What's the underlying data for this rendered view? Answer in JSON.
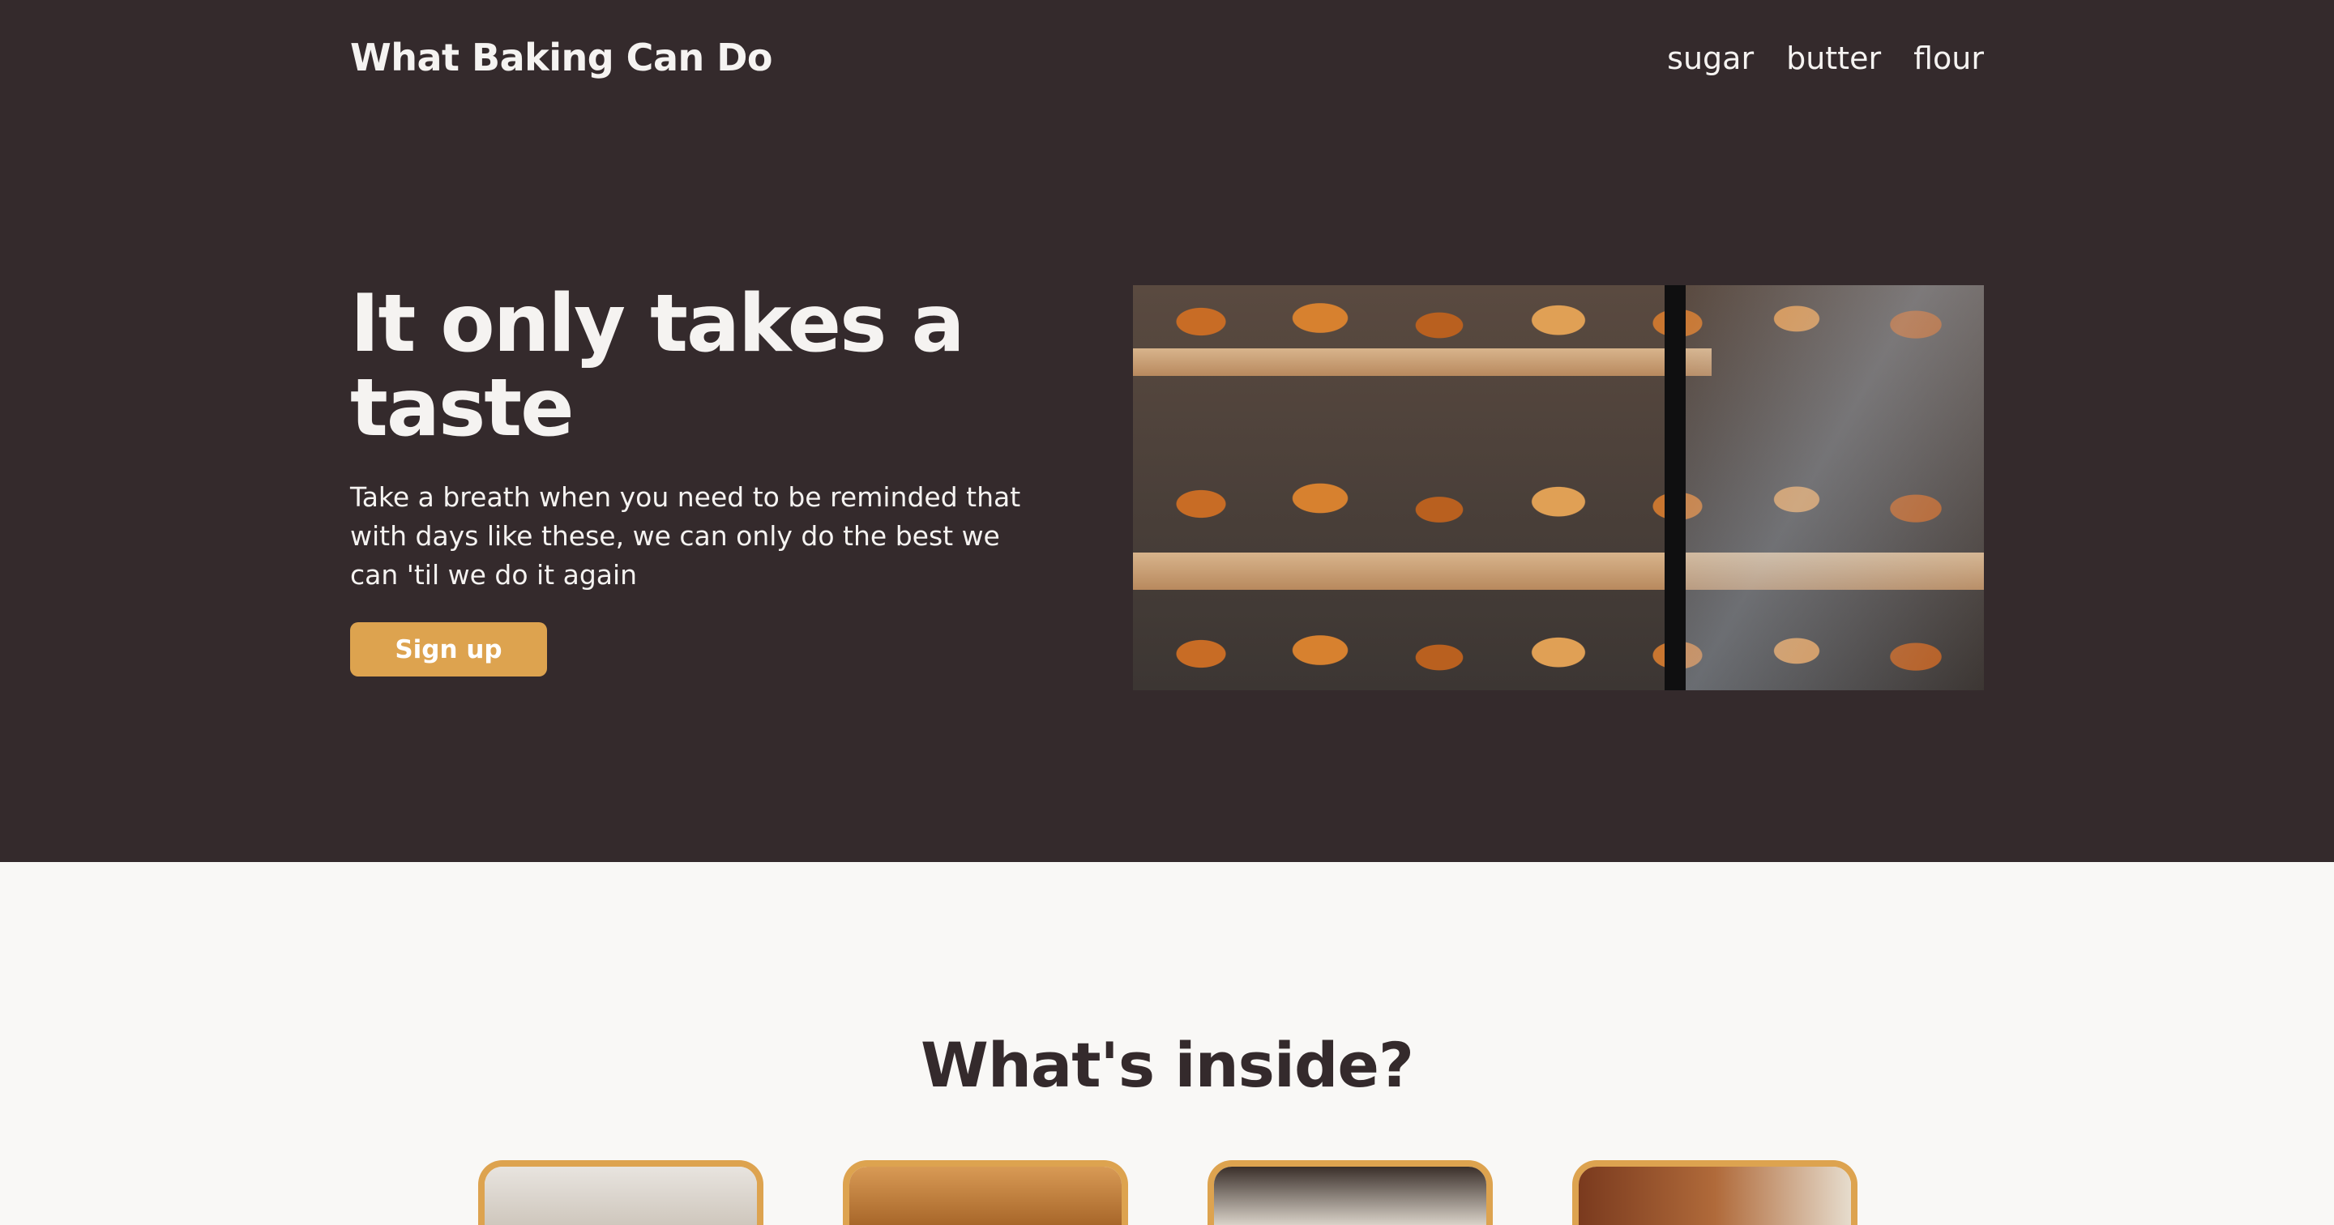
{
  "header": {
    "brand": "What Baking Can Do",
    "nav": [
      "sugar",
      "butter",
      "flour"
    ]
  },
  "hero": {
    "title": "It only takes a taste",
    "text": "Take a breath when you need to be reminded that with days like these, we can only do the best we can 'til we do it again",
    "cta_label": "Sign up"
  },
  "inside": {
    "title": "What's inside?"
  },
  "colors": {
    "hero_bg": "#342a2c",
    "accent": "#dda34f",
    "page_bg": "#f9f8f6",
    "text_light": "#f5f3f1",
    "text_dark": "#342a2c"
  }
}
